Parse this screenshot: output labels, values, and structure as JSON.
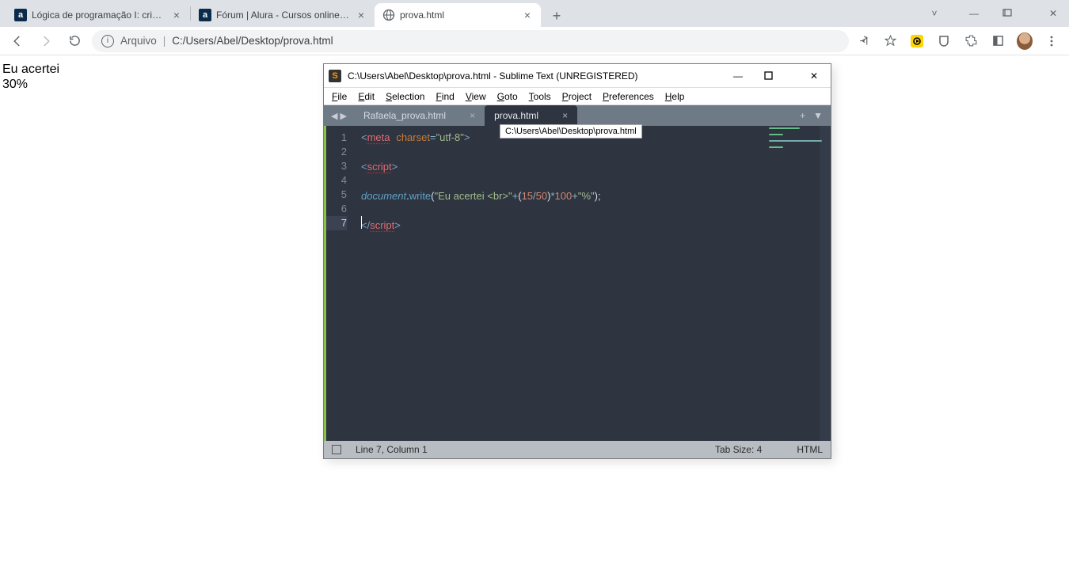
{
  "browser": {
    "tabs": [
      {
        "title": "Lógica de programação I: crie pr",
        "active": false,
        "favicon": "alura"
      },
      {
        "title": "Fórum | Alura - Cursos online de",
        "active": false,
        "favicon": "alura"
      },
      {
        "title": "prova.html",
        "active": true,
        "favicon": "globe"
      }
    ],
    "omnibox": {
      "label": "Arquivo",
      "path": "C:/Users/Abel/Desktop/prova.html"
    }
  },
  "page": {
    "line1": "Eu acertei",
    "line2": "30%"
  },
  "sublime": {
    "title": "C:\\Users\\Abel\\Desktop\\prova.html - Sublime Text (UNREGISTERED)",
    "menu": [
      "File",
      "Edit",
      "Selection",
      "Find",
      "View",
      "Goto",
      "Tools",
      "Project",
      "Preferences",
      "Help"
    ],
    "tabs": [
      {
        "title": "Rafaela_prova.html",
        "active": false
      },
      {
        "title": "prova.html",
        "active": true
      }
    ],
    "tooltip": "C:\\Users\\Abel\\Desktop\\prova.html",
    "gutter": [
      "1",
      "2",
      "3",
      "4",
      "5",
      "6",
      "7"
    ],
    "code": {
      "l1": {
        "meta": "meta",
        "charset": "charset",
        "val": "\"utf-8\""
      },
      "l3_tag": "script",
      "l5": {
        "doc": "document",
        "write": "write",
        "str1": "\"Eu acertei <br>\"",
        "n15": "15",
        "n50": "50",
        "n100": "100",
        "str2": "\"%\""
      },
      "l7_tag": "script"
    },
    "status": {
      "pos": "Line 7, Column 1",
      "tabsize": "Tab Size: 4",
      "lang": "HTML"
    }
  }
}
